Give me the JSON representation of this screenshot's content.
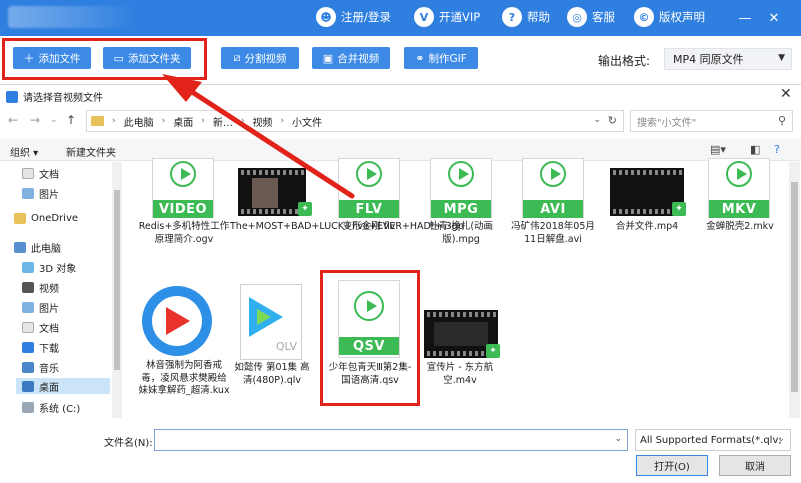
{
  "topbar": {
    "nav": [
      {
        "label": "注册/登录",
        "icon": "user-icon"
      },
      {
        "label": "开通VIP",
        "icon": "vip-icon"
      },
      {
        "label": "帮助",
        "icon": "help-icon"
      },
      {
        "label": "客服",
        "icon": "headset-icon"
      },
      {
        "label": "版权声明",
        "icon": "copyright-icon"
      }
    ],
    "window_controls": [
      "minimize-icon",
      "close-icon"
    ]
  },
  "toolbar": {
    "buttons": [
      {
        "label": "添加文件",
        "icon": "plus-icon"
      },
      {
        "label": "添加文件夹",
        "icon": "folder-icon"
      },
      {
        "label": "分割视频",
        "icon": "split-icon"
      },
      {
        "label": "合并视频",
        "icon": "merge-icon"
      },
      {
        "label": "制作GIF",
        "icon": "gif-icon"
      }
    ],
    "output_format_label": "输出格式:",
    "output_format_value": "MP4  同原文件"
  },
  "dialog": {
    "title": "请选择音视频文件",
    "breadcrumb": [
      "此电脑",
      "桌面",
      "新…",
      "视频",
      "小文件"
    ],
    "search_placeholder": "搜索\"小文件\"",
    "commands": {
      "organize": "组织 ▾",
      "new_folder": "新建文件夹"
    },
    "sidebar": [
      {
        "label": "文档",
        "pinned": true
      },
      {
        "label": "图片",
        "pinned": true
      },
      {
        "label": "OneDrive"
      },
      {
        "label": "此电脑"
      },
      {
        "label": "3D 对象"
      },
      {
        "label": "视频"
      },
      {
        "label": "图片"
      },
      {
        "label": "文档"
      },
      {
        "label": "下载"
      },
      {
        "label": "音乐"
      },
      {
        "label": "桌面",
        "selected": true
      },
      {
        "label": "系统 (C:)"
      }
    ],
    "files": [
      {
        "name": "Redis+多机特性工作原理简介.ogv",
        "badge": "VIDEO"
      },
      {
        "name": "The+MOST+BAD+LUCK+I've+EVER+HAD!+.3gp",
        "badge": ""
      },
      {
        "name": "变形金刚.flv",
        "badge": "FLV"
      },
      {
        "name": "杜青-挣扎(动画版).mpg",
        "badge": "MPG"
      },
      {
        "name": "冯矿伟2018年05月11日解盘.avi",
        "badge": "AVI"
      },
      {
        "name": "合并文件.mp4",
        "badge": ""
      },
      {
        "name": "金蝉脱壳2.mkv",
        "badge": "MKV"
      },
      {
        "name": "林音强制为阿香戒毒，凌风悬求樊殿给妹妹拿解药_超清.kux",
        "badge": ""
      },
      {
        "name": "如懿传 第01集 高清(480P).qlv",
        "badge": "QLV"
      },
      {
        "name": "少年包青天Ⅲ第2集-国语高清.qsv",
        "badge": "QSV"
      },
      {
        "name": "宣传片 - 东方航空.m4v",
        "badge": ""
      }
    ],
    "filename_label": "文件名(N):",
    "filename_value": "",
    "filter_value": "All Supported Formats(*.qlv;",
    "open_button": "打开(O)",
    "cancel_button": "取消"
  },
  "colors": {
    "brand": "#2e7fe0",
    "button": "#3c8ae6",
    "highlight": "#e2231a",
    "file_green": "#3cba54"
  }
}
